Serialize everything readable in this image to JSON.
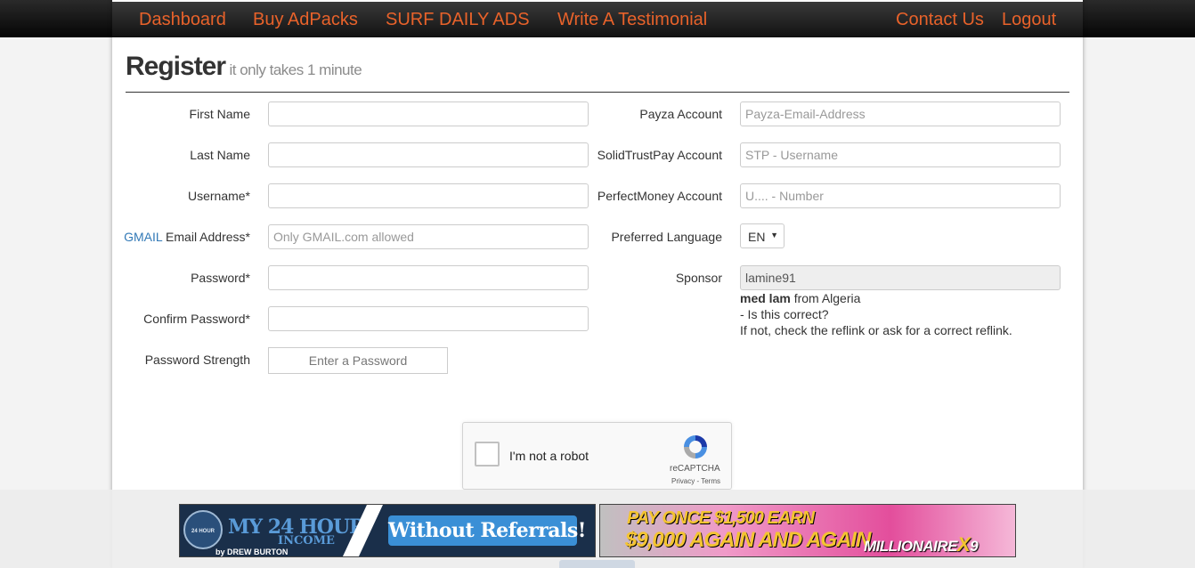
{
  "nav": {
    "left": [
      "Dashboard",
      "Buy AdPacks",
      "SURF DAILY ADS",
      "Write A Testimonial"
    ],
    "right": [
      "Contact Us",
      "Logout"
    ]
  },
  "page": {
    "title": "Register",
    "subtitle": "it only takes 1 minute"
  },
  "form_left": {
    "first_name": {
      "label": "First Name",
      "value": "",
      "placeholder": ""
    },
    "last_name": {
      "label": "Last Name",
      "value": "",
      "placeholder": ""
    },
    "username": {
      "label": "Username*",
      "value": "",
      "placeholder": ""
    },
    "email": {
      "label_highlight": "GMAIL",
      "label": " Email Address*",
      "value": "",
      "placeholder": "Only GMAIL.com allowed"
    },
    "password": {
      "label": "Password*",
      "value": "",
      "placeholder": ""
    },
    "confirm_password": {
      "label": "Confirm Password*",
      "value": "",
      "placeholder": ""
    },
    "strength": {
      "label": "Password Strength",
      "text": "Enter a Password"
    }
  },
  "form_right": {
    "payza": {
      "label": "Payza Account",
      "value": "",
      "placeholder": "Payza-Email-Address"
    },
    "solidtrust": {
      "label": "SolidTrustPay Account",
      "value": "",
      "placeholder": "STP - Username"
    },
    "perfectmoney": {
      "label": "PerfectMoney Account",
      "value": "",
      "placeholder": "U.... - Number"
    },
    "language": {
      "label": "Preferred Language",
      "selected": "EN"
    },
    "sponsor": {
      "label": "Sponsor",
      "value": "lamine91",
      "name": "med lam",
      "location": " from Algeria",
      "question": "- Is this correct?",
      "hint": "If not, check the reflink or ask for a correct reflink."
    }
  },
  "captcha": {
    "label": "I'm not a robot",
    "brand": "reCAPTCHA",
    "privacy": "Privacy",
    "sep": " - ",
    "terms": "Terms"
  },
  "ads": {
    "banner1": {
      "logo": "24 HOUR INCOME",
      "title": "MY 24 HOUR",
      "income": "INCOME",
      "by": "by DREW BURTON",
      "cta": "Without Referrals!"
    },
    "banner2": {
      "line1": "PAY ONCE $1,500 EARN",
      "line2": "$9,000 AGAIN AND AGAIN",
      "brand_a": "MILLIONAIRE",
      "brand_x": "X",
      "brand_b": "9"
    }
  },
  "colors": {
    "nav_link": "#e8622a",
    "navbar": "#1c1c1c",
    "link_blue": "#337ab7"
  }
}
